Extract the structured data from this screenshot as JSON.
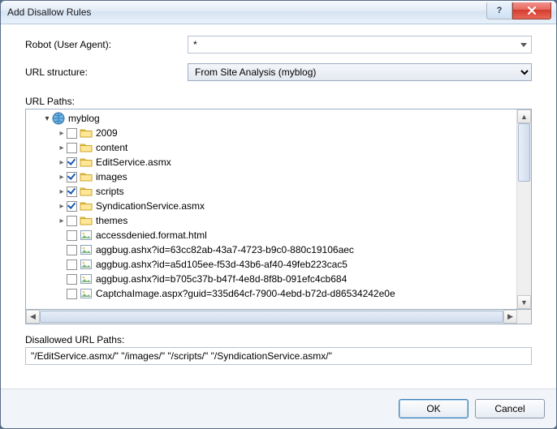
{
  "window": {
    "title": "Add Disallow Rules"
  },
  "labels": {
    "robot": "Robot (User Agent):",
    "url_structure": "URL structure:",
    "url_paths": "URL Paths:",
    "disallowed": "Disallowed URL Paths:"
  },
  "robot": {
    "value": "*"
  },
  "url_structure": {
    "selected": "From Site Analysis (myblog)",
    "options": [
      "From Site Analysis (myblog)"
    ]
  },
  "tree": {
    "root": {
      "label": "myblog",
      "icon": "globe-icon",
      "expanded": true
    },
    "children": [
      {
        "label": "2009",
        "icon": "folder-icon",
        "checked": false,
        "expandable": true
      },
      {
        "label": "content",
        "icon": "folder-icon",
        "checked": false,
        "expandable": true
      },
      {
        "label": "EditService.asmx",
        "icon": "folder-icon",
        "checked": true,
        "expandable": true
      },
      {
        "label": "images",
        "icon": "folder-icon",
        "checked": true,
        "expandable": true
      },
      {
        "label": "scripts",
        "icon": "folder-icon",
        "checked": true,
        "expandable": true
      },
      {
        "label": "SyndicationService.asmx",
        "icon": "folder-icon",
        "checked": true,
        "expandable": true
      },
      {
        "label": "themes",
        "icon": "folder-icon",
        "checked": false,
        "expandable": true
      },
      {
        "label": "accessdenied.format.html",
        "icon": "image-icon",
        "checked": false,
        "expandable": false
      },
      {
        "label": "aggbug.ashx?id=63cc82ab-43a7-4723-b9c0-880c19106aec",
        "icon": "image-icon",
        "checked": false,
        "expandable": false
      },
      {
        "label": "aggbug.ashx?id=a5d105ee-f53d-43b6-af40-49feb223cac5",
        "icon": "image-icon",
        "checked": false,
        "expandable": false
      },
      {
        "label": "aggbug.ashx?id=b705c37b-b47f-4e8d-8f8b-091efc4cb684",
        "icon": "image-icon",
        "checked": false,
        "expandable": false
      },
      {
        "label": "CaptchaImage.aspx?guid=335d64cf-7900-4ebd-b72d-d86534242e0e",
        "icon": "image-icon",
        "checked": false,
        "expandable": false
      }
    ]
  },
  "disallowed_value": "\"/EditService.asmx/\" \"/images/\" \"/scripts/\" \"/SyndicationService.asmx/\"",
  "buttons": {
    "ok": "OK",
    "cancel": "Cancel",
    "help": "?"
  }
}
